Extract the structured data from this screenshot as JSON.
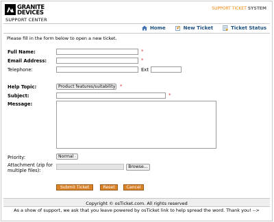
{
  "header": {
    "logo": {
      "line1": "GRANITE",
      "line2": "DEVICES",
      "sub": "SUPPORT CENTER"
    },
    "system_highlight": "SUPPORT TICKET",
    "system_rest": " SYSTEM"
  },
  "nav": [
    {
      "label": "Home",
      "icon": "home-icon"
    },
    {
      "label": "New Ticket",
      "icon": "new-ticket-icon"
    },
    {
      "label": "Ticket Status",
      "icon": "ticket-status-icon"
    }
  ],
  "form": {
    "intro": "Please fill in the form below to open a new ticket.",
    "fullname_label": "Full Name:",
    "email_label": "Email Address:",
    "phone_label": "Telephone:",
    "ext_label": "Ext",
    "topic_label": "Help Topic:",
    "topic_value": "Product features/suitability",
    "subject_label": "Subject:",
    "message_label": "Message:",
    "priority_label": "Priority:",
    "priority_value": "Normal",
    "attachment_label_1": "Attachment (zip for",
    "attachment_label_2": "multiple files):",
    "browse_label": "Browse...",
    "required_mark": "*",
    "submit_label": "Submit Ticket",
    "reset_label": "Reset",
    "cancel_label": "Cancel"
  },
  "footer": {
    "copyright": "Copyright © osTicket.com. All rights reserved",
    "support_note": "As a show of support, we ask that you leave powered by osTicket link to help spread the word. Thank you! -->"
  },
  "colors": {
    "accent": "#f08000",
    "nav_link": "#1a4f82",
    "button": "#d8822a",
    "required": "#e03030"
  }
}
